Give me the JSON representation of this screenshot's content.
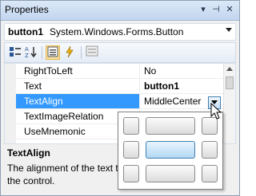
{
  "window": {
    "title": "Properties"
  },
  "object_selector": {
    "name": "button1",
    "type": "System.Windows.Forms.Button"
  },
  "toolbar": {
    "buttons": [
      {
        "icon": "categorized-icon",
        "active": false
      },
      {
        "icon": "alphabetical-icon",
        "active": false
      },
      {
        "icon": "properties-icon",
        "active": true
      },
      {
        "icon": "events-icon",
        "active": false
      },
      {
        "icon": "property-pages-icon",
        "active": false
      }
    ]
  },
  "grid": {
    "rows": [
      {
        "name": "RightToLeft",
        "value": "No",
        "bold": false,
        "selected": false
      },
      {
        "name": "Text",
        "value": "button1",
        "bold": true,
        "selected": false
      },
      {
        "name": "TextAlign",
        "value": "MiddleCenter",
        "bold": false,
        "selected": true
      },
      {
        "name": "TextImageRelation",
        "value": "",
        "bold": false,
        "selected": false
      },
      {
        "name": "UseMnemonic",
        "value": "",
        "bold": false,
        "selected": false
      }
    ]
  },
  "alignment_picker": {
    "selected": "MiddleCenter"
  },
  "description": {
    "title": "TextAlign",
    "text": "The alignment of the text t",
    "text2": "the control."
  }
}
